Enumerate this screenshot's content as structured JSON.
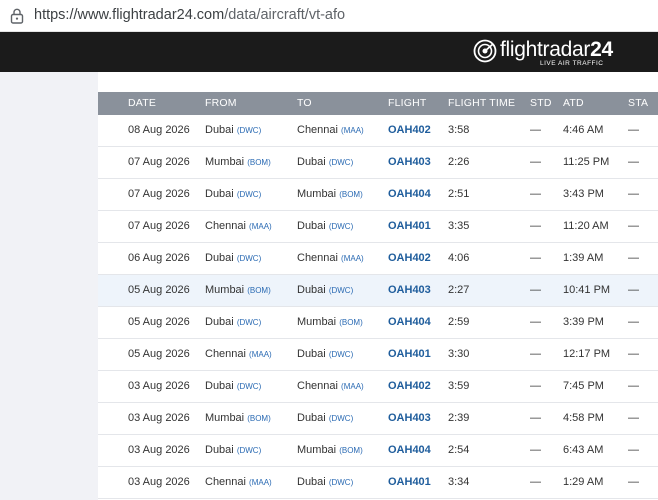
{
  "browser": {
    "url_host": "https://www.flightradar24.com",
    "url_path": "/data/aircraft/vt-afo"
  },
  "site": {
    "logo_text": "flightradar",
    "logo_num": "24",
    "logo_tagline": "LIVE AIR TRAFFIC"
  },
  "table": {
    "headers": [
      "DATE",
      "FROM",
      "TO",
      "FLIGHT",
      "FLIGHT TIME",
      "STD",
      "ATD",
      "STA"
    ],
    "rows": [
      {
        "date": "08 Aug 2026",
        "from": "Dubai",
        "from_code": "(DWC)",
        "to": "Chennai",
        "to_code": "(MAA)",
        "flight": "OAH402",
        "time": "3:58",
        "std": "—",
        "atd": "4:46 AM",
        "sta": "—"
      },
      {
        "date": "07 Aug 2026",
        "from": "Mumbai",
        "from_code": "(BOM)",
        "to": "Dubai",
        "to_code": "(DWC)",
        "flight": "OAH403",
        "time": "2:26",
        "std": "—",
        "atd": "11:25 PM",
        "sta": "—"
      },
      {
        "date": "07 Aug 2026",
        "from": "Dubai",
        "from_code": "(DWC)",
        "to": "Mumbai",
        "to_code": "(BOM)",
        "flight": "OAH404",
        "time": "2:51",
        "std": "—",
        "atd": "3:43 PM",
        "sta": "—"
      },
      {
        "date": "07 Aug 2026",
        "from": "Chennai",
        "from_code": "(MAA)",
        "to": "Dubai",
        "to_code": "(DWC)",
        "flight": "OAH401",
        "time": "3:35",
        "std": "—",
        "atd": "11:20 AM",
        "sta": "—"
      },
      {
        "date": "06 Aug 2026",
        "from": "Dubai",
        "from_code": "(DWC)",
        "to": "Chennai",
        "to_code": "(MAA)",
        "flight": "OAH402",
        "time": "4:06",
        "std": "—",
        "atd": "1:39 AM",
        "sta": "—"
      },
      {
        "date": "05 Aug 2026",
        "from": "Mumbai",
        "from_code": "(BOM)",
        "to": "Dubai",
        "to_code": "(DWC)",
        "flight": "OAH403",
        "time": "2:27",
        "std": "—",
        "atd": "10:41 PM",
        "sta": "—"
      },
      {
        "date": "05 Aug 2026",
        "from": "Dubai",
        "from_code": "(DWC)",
        "to": "Mumbai",
        "to_code": "(BOM)",
        "flight": "OAH404",
        "time": "2:59",
        "std": "—",
        "atd": "3:39 PM",
        "sta": "—"
      },
      {
        "date": "05 Aug 2026",
        "from": "Chennai",
        "from_code": "(MAA)",
        "to": "Dubai",
        "to_code": "(DWC)",
        "flight": "OAH401",
        "time": "3:30",
        "std": "—",
        "atd": "12:17 PM",
        "sta": "—"
      },
      {
        "date": "03 Aug 2026",
        "from": "Dubai",
        "from_code": "(DWC)",
        "to": "Chennai",
        "to_code": "(MAA)",
        "flight": "OAH402",
        "time": "3:59",
        "std": "—",
        "atd": "7:45 PM",
        "sta": "—"
      },
      {
        "date": "03 Aug 2026",
        "from": "Mumbai",
        "from_code": "(BOM)",
        "to": "Dubai",
        "to_code": "(DWC)",
        "flight": "OAH403",
        "time": "2:39",
        "std": "—",
        "atd": "4:58 PM",
        "sta": "—"
      },
      {
        "date": "03 Aug 2026",
        "from": "Dubai",
        "from_code": "(DWC)",
        "to": "Mumbai",
        "to_code": "(BOM)",
        "flight": "OAH404",
        "time": "2:54",
        "std": "—",
        "atd": "6:43 AM",
        "sta": "—"
      },
      {
        "date": "03 Aug 2026",
        "from": "Chennai",
        "from_code": "(MAA)",
        "to": "Dubai",
        "to_code": "(DWC)",
        "flight": "OAH401",
        "time": "3:34",
        "std": "—",
        "atd": "1:29 AM",
        "sta": "—"
      }
    ]
  },
  "colors": {
    "header_bar": "#1b1b1b",
    "table_header": "#8a919b",
    "link": "#1f5d9c",
    "code": "#2a6ab3",
    "highlight_row": "#eef4fb"
  }
}
